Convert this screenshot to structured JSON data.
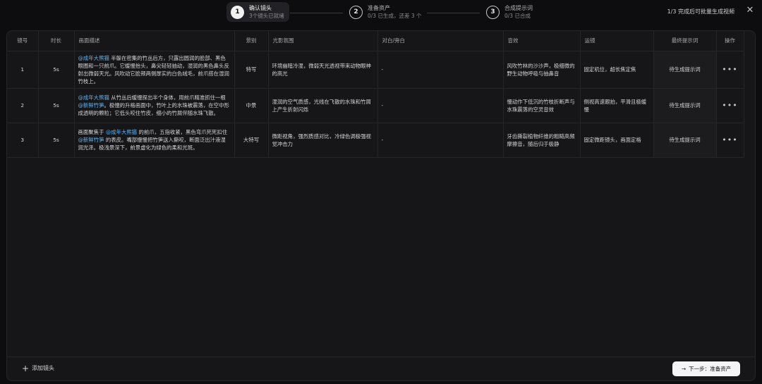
{
  "stepper": {
    "steps": [
      {
        "num": "1",
        "title": "确认镜头",
        "sub": "3个镜头已就绪"
      },
      {
        "num": "2",
        "title": "准备资产",
        "sub": "0/3 已生成，还差 3 个"
      },
      {
        "num": "3",
        "title": "合成提示词",
        "sub": "0/3 已合成"
      }
    ]
  },
  "header": {
    "batch_hint": "1/3 完成后可批量生成视频",
    "close_icon": "✕"
  },
  "table": {
    "columns": [
      "镜号",
      "时长",
      "画面描述",
      "景别",
      "光影氛围",
      "对白/旁白",
      "音效",
      "运镜",
      "最终提示词",
      "操作"
    ],
    "rows": [
      {
        "idx": "1",
        "duration": "5s",
        "desc": {
          "parts": [
            {
              "text": "@成年大熊猫",
              "mention": true
            },
            {
              "text": " 半躲在密集的竹丛后方，只露出圆润的脸部、黑色眼圈和一只前爪。它缓慢抬头，鼻尖轻轻抽动，湿润的黑色鼻头反射出微弱天光。风吹动它脸颊两侧厚实的白色绒毛，前爪搭在湿润竹枝上。",
              "mention": false
            }
          ]
        },
        "shot": "特写",
        "lighting": "环境幽暗冷湿，微弱天光透视带来动物眼神的高光",
        "dialog": "-",
        "sound": "风吹竹林的沙沙声，极细微的野生动物呼吸与抽鼻音",
        "camera": "固定机位，超长焦定焦",
        "final": "待生成提示词",
        "action": "•••"
      },
      {
        "idx": "2",
        "duration": "5s",
        "desc": {
          "parts": [
            {
              "text": "@成年大熊猫",
              "mention": true
            },
            {
              "text": " 从竹丛后缓慢探出半个身体，用前爪精准抓住一根 ",
              "mention": false
            },
            {
              "text": "@新鲜竹笋",
              "mention": true
            },
            {
              "text": "。极慢的升格画面中，竹叶上的水珠被震落，在空中形成透明的颗粒；它低头咬住竹皮，细小的竹屑伴随水珠飞散。",
              "mention": false
            }
          ]
        },
        "shot": "中景",
        "lighting": "湿润的空气质感，光线在飞散的水珠和竹屑上产生折射闪烁",
        "dialog": "-",
        "sound": "慢动作下低沉的竹枝折断声与水珠震落的空灵音效",
        "camera": "侧视高速跟拍，平滑且极缓慢",
        "final": "待生成提示词",
        "action": "•••"
      },
      {
        "idx": "3",
        "duration": "5s",
        "desc": {
          "parts": [
            {
              "text": "画面聚焦于 ",
              "mention": false
            },
            {
              "text": "@成年大熊猫",
              "mention": true
            },
            {
              "text": " 的前爪，五指收紧，黑色弯爪死死扣住 ",
              "mention": false
            },
            {
              "text": "@新鲜竹笋",
              "mention": true
            },
            {
              "text": " 的表皮。嘴部慢慢把竹笋送入撕咬，断面泛出汁液湿润光泽。极浅景深下，前景虚化为绿色的柔和光斑。",
              "mention": false
            }
          ]
        },
        "shot": "大特写",
        "lighting": "微距视角，强烈质感对比，冷绿色调极强视觉冲击力",
        "dialog": "-",
        "sound": "牙齿撕裂植物纤维的粗糙高频摩擦音，随后归于极静",
        "camera": "固定微距镜头，画面定格",
        "final": "待生成提示词",
        "action": "•••"
      }
    ]
  },
  "footer": {
    "add_shot": "添加镜头",
    "next": "下一步：准备资产"
  }
}
